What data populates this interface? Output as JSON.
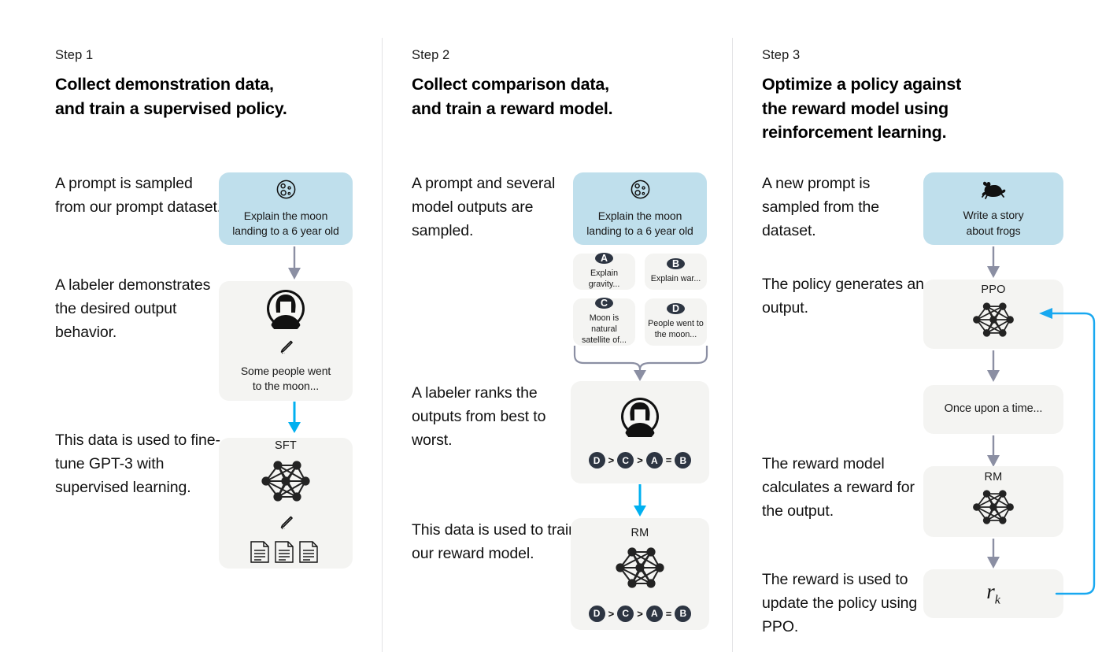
{
  "diagram": {
    "title_semantic": "rlhf-three-step-diagram",
    "colors": {
      "prompt_box": "#bfdfec",
      "model_box": "#f4f4f2",
      "grey_arrow": "#8b8fa3",
      "cyan_arrow": "#00b0f0",
      "badge": "#2d3542",
      "divider": "#e3e3e5"
    }
  },
  "columns": [
    {
      "step_label": "Step 1",
      "title_line1": "Collect demonstration data,",
      "title_line2": "and train a supervised policy.",
      "paragraphs": [
        "A prompt is sampled from our prompt dataset.",
        "A labeler demonstrates the desired output behavior.",
        "This data is used to fine-tune GPT-3 with supervised learning."
      ],
      "prompt_box": {
        "icon": "moon-icon",
        "line1": "Explain the moon",
        "line2": "landing to a 6 year old"
      },
      "labeler_box": {
        "icon": "labeler-avatar-icon",
        "pencil": "pencil-icon",
        "line1": "Some people went",
        "line2": "to the moon..."
      },
      "model_box": {
        "caption": "SFT",
        "network": "neural-network-icon",
        "pencil": "pencil-icon",
        "docs": "document-icon"
      }
    },
    {
      "step_label": "Step 2",
      "title_line1": "Collect comparison data,",
      "title_line2": "and train a reward model.",
      "paragraphs": [
        "A prompt and several model outputs are sampled.",
        "A labeler ranks the outputs from best to worst.",
        "This data is used to train our reward model."
      ],
      "prompt_box": {
        "icon": "moon-icon",
        "line1": "Explain the moon",
        "line2": "landing to a 6 year old"
      },
      "outputs": [
        {
          "badge": "A",
          "text": "Explain gravity..."
        },
        {
          "badge": "B",
          "text": "Explain war..."
        },
        {
          "badge": "C",
          "text": "Moon is natural satellite of..."
        },
        {
          "badge": "D",
          "text": "People went to the moon..."
        }
      ],
      "ranking_box": {
        "icon": "labeler-avatar-icon",
        "ranking": [
          "D",
          ">",
          "C",
          ">",
          "A",
          "=",
          "B"
        ]
      },
      "reward_model_box": {
        "caption": "RM",
        "network": "neural-network-icon",
        "ranking": [
          "D",
          ">",
          "C",
          ">",
          "A",
          "=",
          "B"
        ]
      }
    },
    {
      "step_label": "Step 3",
      "title_line1": "Optimize a policy against",
      "title_line2": "the reward model using",
      "title_line3": "reinforcement learning.",
      "paragraphs": [
        "A new prompt is sampled from the dataset.",
        "The policy generates an output.",
        "The reward model calculates a reward for the output.",
        "The reward is used to update the policy using PPO."
      ],
      "prompt_box": {
        "icon": "frog-icon",
        "line1": "Write a story",
        "line2": "about frogs"
      },
      "policy_box": {
        "caption": "PPO",
        "network": "neural-network-icon"
      },
      "output_box": {
        "text": "Once upon a time..."
      },
      "reward_model_box": {
        "caption": "RM",
        "network": "neural-network-icon"
      },
      "reward_box": {
        "symbol": "r",
        "subscript": "k"
      }
    }
  ]
}
